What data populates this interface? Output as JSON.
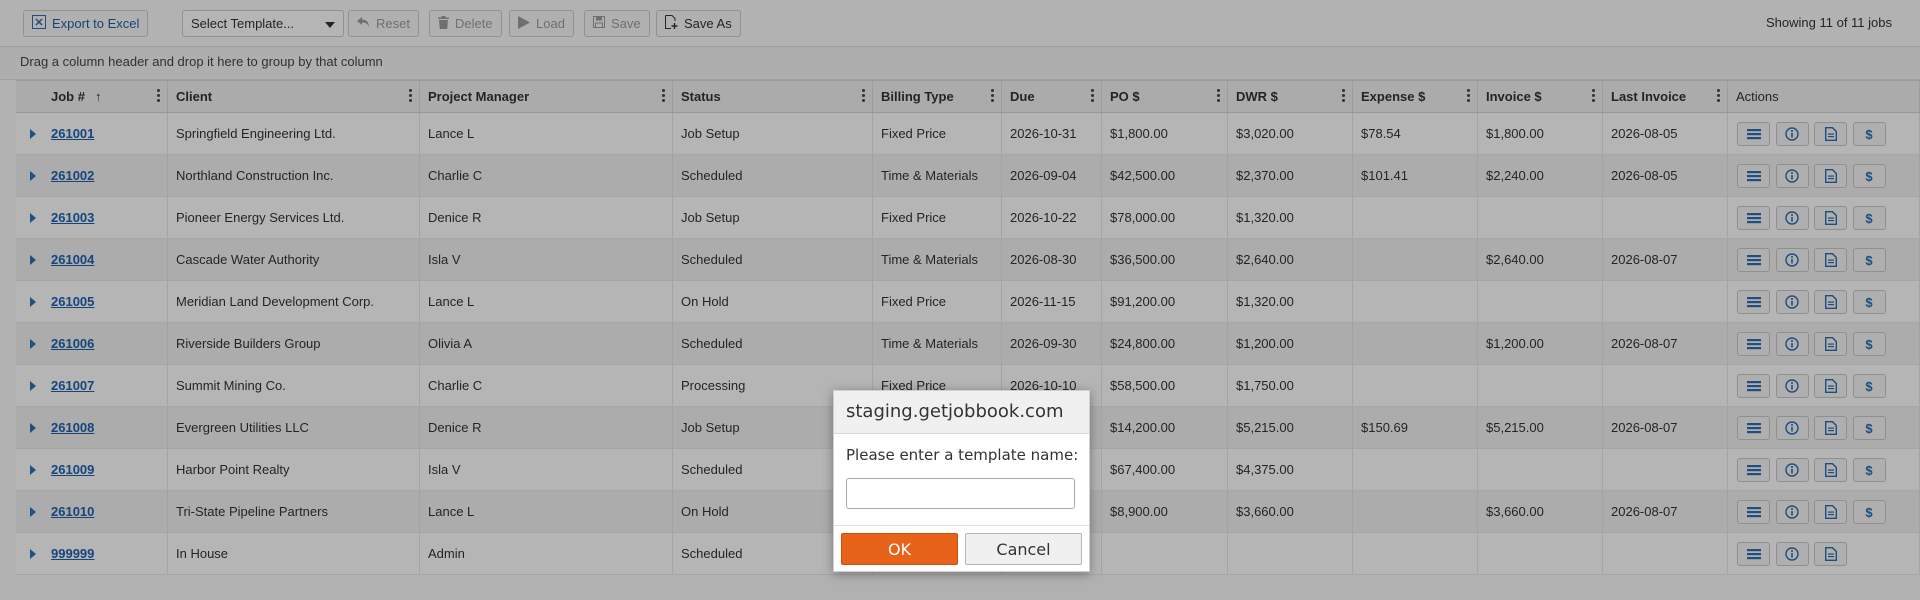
{
  "toolbar": {
    "export_label": "Export to Excel",
    "select_template_value": "Select Template...",
    "reset_label": "Reset",
    "delete_label": "Delete",
    "load_label": "Load",
    "save_label": "Save",
    "save_as_label": "Save As",
    "job_count": "Showing 11 of 11 jobs"
  },
  "group_bar": {
    "hint": "Drag a column header and drop it here to group by that column"
  },
  "grid": {
    "columns": [
      "Job #",
      "Client",
      "Project Manager",
      "Status",
      "Billing Type",
      "Due",
      "PO $",
      "DWR $",
      "Expense $",
      "Invoice $",
      "Last Invoice",
      "Actions"
    ],
    "sort_indicator": "↑",
    "rows": [
      [
        "261001",
        "Springfield Engineering Ltd.",
        "Lance L",
        "Job Setup",
        "Fixed Price",
        "2026-10-31",
        "$1,800.00",
        "$3,020.00",
        "$78.54",
        "$1,800.00",
        "2026-08-05"
      ],
      [
        "261002",
        "Northland Construction Inc.",
        "Charlie C",
        "Scheduled",
        "Time & Materials",
        "2026-09-04",
        "$42,500.00",
        "$2,370.00",
        "$101.41",
        "$2,240.00",
        "2026-08-05"
      ],
      [
        "261003",
        "Pioneer Energy Services Ltd.",
        "Denice R",
        "Job Setup",
        "Fixed Price",
        "2026-10-22",
        "$78,000.00",
        "$1,320.00",
        "",
        "",
        ""
      ],
      [
        "261004",
        "Cascade Water Authority",
        "Isla V",
        "Scheduled",
        "Time & Materials",
        "2026-08-30",
        "$36,500.00",
        "$2,640.00",
        "",
        "$2,640.00",
        "2026-08-07"
      ],
      [
        "261005",
        "Meridian Land Development Corp.",
        "Lance L",
        "On Hold",
        "Fixed Price",
        "2026-11-15",
        "$91,200.00",
        "$1,320.00",
        "",
        "",
        ""
      ],
      [
        "261006",
        "Riverside Builders Group",
        "Olivia A",
        "Scheduled",
        "Time & Materials",
        "2026-09-30",
        "$24,800.00",
        "$1,200.00",
        "",
        "$1,200.00",
        "2026-08-07"
      ],
      [
        "261007",
        "Summit Mining Co.",
        "Charlie C",
        "Processing",
        "Fixed Price",
        "2026-10-10",
        "$58,500.00",
        "$1,750.00",
        "",
        "",
        ""
      ],
      [
        "261008",
        "Evergreen Utilities LLC",
        "Denice R",
        "Job Setup",
        "",
        "",
        "$14,200.00",
        "$5,215.00",
        "$150.69",
        "$5,215.00",
        "2026-08-07"
      ],
      [
        "261009",
        "Harbor Point Realty",
        "Isla V",
        "Scheduled",
        "",
        "",
        "$67,400.00",
        "$4,375.00",
        "",
        "",
        ""
      ],
      [
        "261010",
        "Tri-State Pipeline Partners",
        "Lance L",
        "On Hold",
        "",
        "",
        "$8,900.00",
        "$3,660.00",
        "",
        "$3,660.00",
        "2026-08-07"
      ],
      [
        "999999",
        "In House",
        "Admin",
        "Scheduled",
        "",
        "",
        "",
        "",
        "",
        "",
        ""
      ]
    ],
    "dollar_action": "$"
  },
  "dialog": {
    "title": "staging.getjobbook.com",
    "message": "Please enter a template name:",
    "input_value": "",
    "ok_label": "OK",
    "cancel_label": "Cancel"
  },
  "colors": {
    "accent": "#e8631a",
    "link": "#1f5fae",
    "overlay": "rgba(0,0,0,0.28)"
  }
}
